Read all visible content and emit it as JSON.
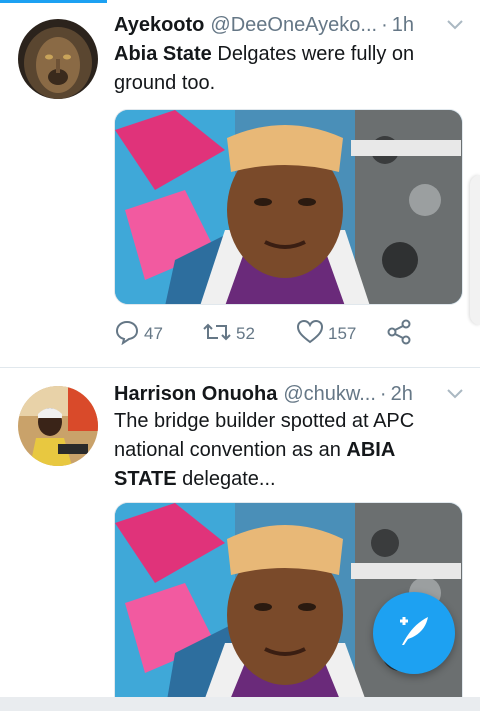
{
  "tweets": [
    {
      "name": "Ayekooto",
      "handle": "@DeeOneAyeko...",
      "separator": "·",
      "time": "1h",
      "text_bold": "Abia State",
      "text_rest": " Delgates were fully on ground too.",
      "avatar_icon": "lion-avatar",
      "actions": {
        "replies": "47",
        "retweets": "52",
        "likes": "157"
      }
    },
    {
      "name": "Harrison Onuoha",
      "handle": "@chukw...",
      "separator": "·",
      "time": "2h",
      "text_pre": "The bridge builder spotted at APC national convention as an ",
      "text_bold": "ABIA STATE",
      "text_post": " delegate...",
      "avatar_icon": "person-avatar"
    }
  ],
  "colors": {
    "accent": "#1da1f2",
    "secondary_text": "#657786",
    "primary_text": "#14171a"
  },
  "icons": [
    "reply-icon",
    "retweet-icon",
    "like-icon",
    "share-icon",
    "chevron-down-icon",
    "compose-tweet-icon"
  ]
}
